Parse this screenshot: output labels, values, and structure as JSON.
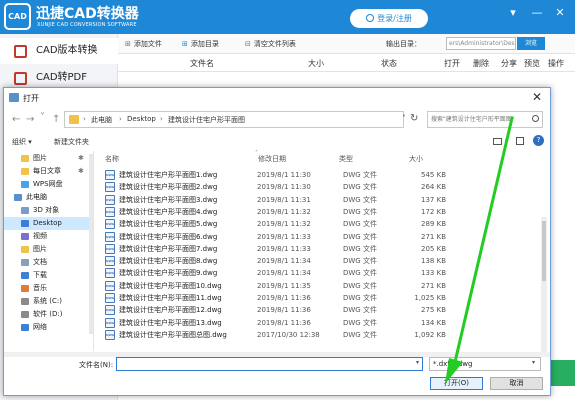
{
  "app": {
    "logo": "CAD",
    "name": "迅捷CAD转换器",
    "subtitle": "XUNJIE CAD CONVERSION SOFTWARE",
    "login": "登录/注册",
    "window_controls": [
      "▾",
      "—",
      "✕"
    ],
    "sidebar": [
      {
        "label": "CAD版本转换"
      },
      {
        "label": "CAD转PDF"
      }
    ],
    "toolbar": {
      "add_file": "添加文件",
      "add_dir": "添加目录",
      "clear_list": "清空文件列表",
      "output_label": "输出目录：",
      "output_path": "ers\\Administrator\\Desktop",
      "browse": "浏览"
    },
    "columns": [
      "文件名",
      "大小",
      "状态",
      "打开",
      "删除",
      "分享",
      "预览",
      "操作"
    ]
  },
  "dialog": {
    "title": "打开",
    "close": "✕",
    "nav": {
      "back": "←",
      "forward": "→",
      "recent": "˅",
      "up": "↑"
    },
    "breadcrumb": [
      "此电脑",
      "Desktop",
      "建筑设计住宅户形平面图"
    ],
    "breadcrumb_sep": "›",
    "search_placeholder": "搜索\"建筑设计住宅户形平面图\"",
    "organize": "组织 ▾",
    "new_folder": "新建文件夹",
    "nav_pane": [
      {
        "label": "图片",
        "pinned": true
      },
      {
        "label": "每日文章",
        "pinned": true
      },
      {
        "label": "WPS网盘",
        "pinned": false
      },
      {
        "label": "此电脑",
        "pinned": false
      },
      {
        "label": "3D 对象",
        "pinned": false
      },
      {
        "label": "Desktop",
        "pinned": false
      },
      {
        "label": "视频",
        "pinned": false
      },
      {
        "label": "图片",
        "pinned": false
      },
      {
        "label": "文档",
        "pinned": false
      },
      {
        "label": "下载",
        "pinned": false
      },
      {
        "label": "音乐",
        "pinned": false
      },
      {
        "label": "系统 (C:)",
        "pinned": false
      },
      {
        "label": "软件 (D:)",
        "pinned": false
      },
      {
        "label": "网络",
        "pinned": false
      }
    ],
    "pin_glyph": "✱",
    "headers": {
      "name": "名称",
      "date": "修改日期",
      "type": "类型",
      "size": "大小"
    },
    "file_icon_label": "DWG",
    "files": [
      {
        "name": "建筑设计住宅户形平面图1.dwg",
        "date": "2019/8/1 11:30",
        "type": "DWG 文件",
        "size": "545 KB"
      },
      {
        "name": "建筑设计住宅户形平面图2.dwg",
        "date": "2019/8/1 11:30",
        "type": "DWG 文件",
        "size": "264 KB"
      },
      {
        "name": "建筑设计住宅户形平面图3.dwg",
        "date": "2019/8/1 11:31",
        "type": "DWG 文件",
        "size": "137 KB"
      },
      {
        "name": "建筑设计住宅户形平面图4.dwg",
        "date": "2019/8/1 11:32",
        "type": "DWG 文件",
        "size": "172 KB"
      },
      {
        "name": "建筑设计住宅户形平面图5.dwg",
        "date": "2019/8/1 11:32",
        "type": "DWG 文件",
        "size": "289 KB"
      },
      {
        "name": "建筑设计住宅户形平面图6.dwg",
        "date": "2019/8/1 11:33",
        "type": "DWG 文件",
        "size": "271 KB"
      },
      {
        "name": "建筑设计住宅户形平面图7.dwg",
        "date": "2019/8/1 11:33",
        "type": "DWG 文件",
        "size": "205 KB"
      },
      {
        "name": "建筑设计住宅户形平面图8.dwg",
        "date": "2019/8/1 11:34",
        "type": "DWG 文件",
        "size": "138 KB"
      },
      {
        "name": "建筑设计住宅户形平面图9.dwg",
        "date": "2019/8/1 11:34",
        "type": "DWG 文件",
        "size": "133 KB"
      },
      {
        "name": "建筑设计住宅户形平面图10.dwg",
        "date": "2019/8/1 11:35",
        "type": "DWG 文件",
        "size": "271 KB"
      },
      {
        "name": "建筑设计住宅户形平面图11.dwg",
        "date": "2019/8/1 11:36",
        "type": "DWG 文件",
        "size": "1,025 KB"
      },
      {
        "name": "建筑设计住宅户形平面图12.dwg",
        "date": "2019/8/1 11:36",
        "type": "DWG 文件",
        "size": "275 KB"
      },
      {
        "name": "建筑设计住宅户形平面图13.dwg",
        "date": "2019/8/1 11:36",
        "type": "DWG 文件",
        "size": "134 KB"
      },
      {
        "name": "建筑设计住宅户形平面图总图.dwg",
        "date": "2017/10/30 12:38",
        "type": "DWG 文件",
        "size": "1,092 KB"
      }
    ],
    "filename_label": "文件名(N):",
    "filename_value": "",
    "filter": "*.dxf;*.dwg",
    "open": "打开(O)",
    "cancel": "取消"
  },
  "colors": {
    "brand": "#1e88d6",
    "arrow": "#22cc22",
    "selection": "#cde8ff"
  }
}
